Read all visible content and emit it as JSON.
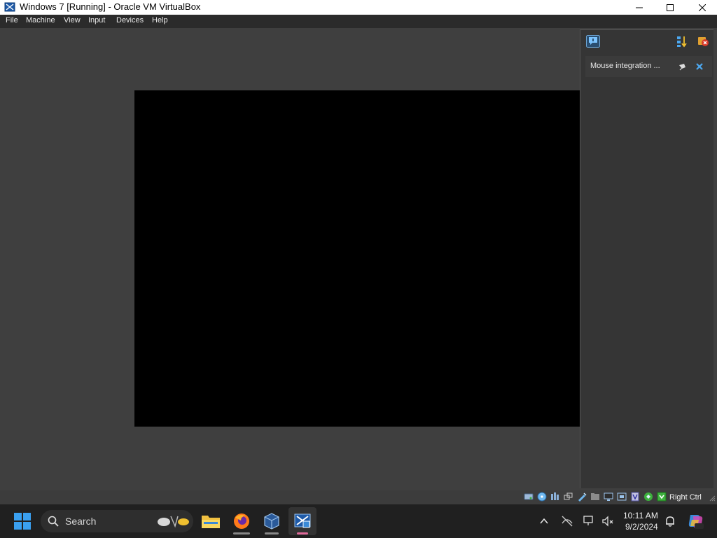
{
  "window": {
    "title": "Windows 7 [Running] - Oracle VM VirtualBox"
  },
  "menu": {
    "items": [
      "File",
      "Machine",
      "View",
      "Input",
      "Devices",
      "Help"
    ]
  },
  "notification_center": {
    "items": [
      {
        "text": "Mouse integration ..."
      }
    ]
  },
  "statusbar": {
    "host_key": "Right Ctrl"
  },
  "taskbar": {
    "search_label": "Search",
    "time": "10:11 AM",
    "date": "9/2/2024"
  },
  "colors": {
    "window_bg": "#3f3f3f",
    "menubar_bg": "#2b2b2b",
    "taskbar_bg": "#202020",
    "accent": "#4ca8f0"
  }
}
